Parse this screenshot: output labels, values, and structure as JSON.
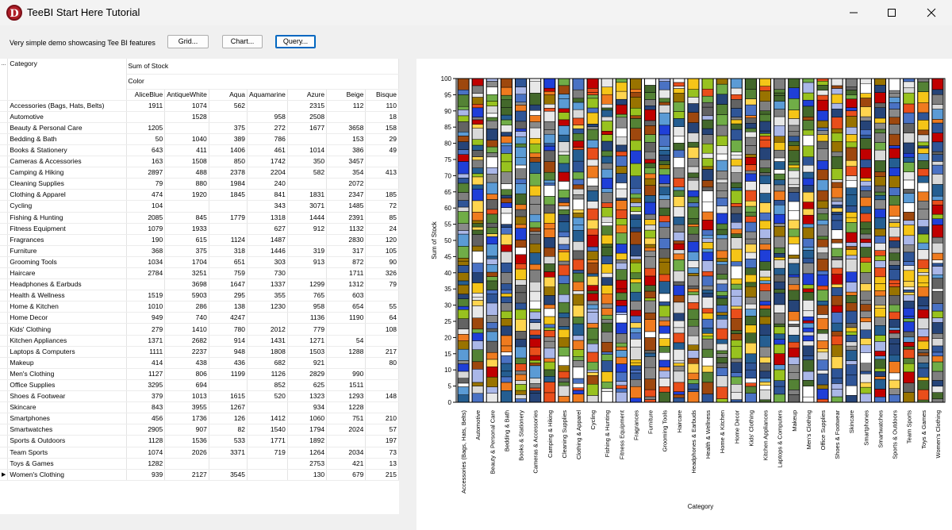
{
  "window": {
    "title": "TeeBI Start Here Tutorial",
    "app_icon_letter": "D"
  },
  "toolbar": {
    "description": "Very simple demo showcasing Tee BI features",
    "grid_label": "Grid...",
    "chart_label": "Chart...",
    "query_label": "Query..."
  },
  "grid": {
    "corner": "...",
    "category_header": "Category",
    "measure_header": "Sum of Stock",
    "column_group_header": "Color",
    "columns": [
      "AliceBlue",
      "AntiqueWhite",
      "Aqua",
      "Aquamarine",
      "Azure",
      "Beige",
      "Bisque"
    ],
    "row_indicator": "▶",
    "rows": [
      {
        "category": "Accessories (Bags, Hats, Belts)",
        "values": [
          "1911",
          "1074",
          "562",
          "",
          "2315",
          "112",
          "110"
        ]
      },
      {
        "category": "Automotive",
        "values": [
          "",
          "1528",
          "",
          "958",
          "2508",
          "",
          "18"
        ]
      },
      {
        "category": "Beauty & Personal Care",
        "values": [
          "1205",
          "",
          "375",
          "272",
          "1677",
          "3658",
          "158"
        ]
      },
      {
        "category": "Bedding & Bath",
        "values": [
          "50",
          "1040",
          "389",
          "786",
          "",
          "153",
          "29"
        ]
      },
      {
        "category": "Books & Stationery",
        "values": [
          "643",
          "411",
          "1406",
          "461",
          "1014",
          "386",
          "49"
        ]
      },
      {
        "category": "Cameras & Accessories",
        "values": [
          "163",
          "1508",
          "850",
          "1742",
          "350",
          "3457",
          ""
        ]
      },
      {
        "category": "Camping & Hiking",
        "values": [
          "2897",
          "488",
          "2378",
          "2204",
          "582",
          "354",
          "413"
        ]
      },
      {
        "category": "Cleaning Supplies",
        "values": [
          "79",
          "880",
          "1984",
          "240",
          "",
          "2072",
          ""
        ]
      },
      {
        "category": "Clothing & Apparel",
        "values": [
          "474",
          "1920",
          "1845",
          "841",
          "1831",
          "2347",
          "185"
        ]
      },
      {
        "category": "Cycling",
        "values": [
          "104",
          "",
          "",
          "343",
          "3071",
          "1485",
          "72"
        ]
      },
      {
        "category": "Fishing & Hunting",
        "values": [
          "2085",
          "845",
          "1779",
          "1318",
          "1444",
          "2391",
          "85"
        ]
      },
      {
        "category": "Fitness Equipment",
        "values": [
          "1079",
          "1933",
          "",
          "627",
          "912",
          "1132",
          "24"
        ]
      },
      {
        "category": "Fragrances",
        "values": [
          "190",
          "615",
          "1124",
          "1487",
          "",
          "2830",
          "120"
        ]
      },
      {
        "category": "Furniture",
        "values": [
          "368",
          "375",
          "318",
          "1446",
          "319",
          "317",
          "105"
        ]
      },
      {
        "category": "Grooming Tools",
        "values": [
          "1034",
          "1704",
          "651",
          "303",
          "913",
          "872",
          "90"
        ]
      },
      {
        "category": "Haircare",
        "values": [
          "2784",
          "3251",
          "759",
          "730",
          "",
          "1711",
          "326"
        ]
      },
      {
        "category": "Headphones & Earbuds",
        "values": [
          "",
          "3698",
          "1647",
          "1337",
          "1299",
          "1312",
          "79"
        ]
      },
      {
        "category": "Health & Wellness",
        "values": [
          "1519",
          "5903",
          "295",
          "355",
          "765",
          "603",
          ""
        ]
      },
      {
        "category": "Home & Kitchen",
        "values": [
          "1010",
          "286",
          "138",
          "1230",
          "958",
          "654",
          "55"
        ]
      },
      {
        "category": "Home Decor",
        "values": [
          "949",
          "740",
          "4247",
          "",
          "1136",
          "1190",
          "64"
        ]
      },
      {
        "category": "Kids' Clothing",
        "values": [
          "279",
          "1410",
          "780",
          "2012",
          "779",
          "",
          "108"
        ]
      },
      {
        "category": "Kitchen Appliances",
        "values": [
          "1371",
          "2682",
          "914",
          "1431",
          "1271",
          "54",
          ""
        ]
      },
      {
        "category": "Laptops & Computers",
        "values": [
          "1111",
          "2237",
          "948",
          "1808",
          "1503",
          "1288",
          "217"
        ]
      },
      {
        "category": "Makeup",
        "values": [
          "414",
          "438",
          "436",
          "682",
          "921",
          "",
          "80"
        ]
      },
      {
        "category": "Men's Clothing",
        "values": [
          "1127",
          "806",
          "1199",
          "1126",
          "2829",
          "990",
          ""
        ]
      },
      {
        "category": "Office Supplies",
        "values": [
          "3295",
          "694",
          "",
          "852",
          "625",
          "1511",
          ""
        ]
      },
      {
        "category": "Shoes & Footwear",
        "values": [
          "379",
          "1013",
          "1615",
          "520",
          "1323",
          "1293",
          "148"
        ]
      },
      {
        "category": "Skincare",
        "values": [
          "843",
          "3955",
          "1267",
          "",
          "934",
          "1228",
          ""
        ]
      },
      {
        "category": "Smartphones",
        "values": [
          "456",
          "1736",
          "126",
          "1412",
          "1060",
          "751",
          "210"
        ]
      },
      {
        "category": "Smartwatches",
        "values": [
          "2905",
          "907",
          "82",
          "1540",
          "1794",
          "2024",
          "57"
        ]
      },
      {
        "category": "Sports & Outdoors",
        "values": [
          "1128",
          "1536",
          "533",
          "1771",
          "1892",
          "",
          "197"
        ]
      },
      {
        "category": "Team Sports",
        "values": [
          "1074",
          "2026",
          "3371",
          "719",
          "1264",
          "2034",
          "73"
        ]
      },
      {
        "category": "Toys & Games",
        "values": [
          "1282",
          "",
          "",
          "",
          "2753",
          "421",
          "13"
        ]
      },
      {
        "category": "Women's Clothing",
        "values": [
          "939",
          "2127",
          "3545",
          "",
          "130",
          "679",
          "215"
        ]
      }
    ]
  },
  "chart_data": {
    "type": "bar",
    "stacking": "100% stacked",
    "ylabel": "Sum of Stock",
    "xlabel": "Category",
    "ylim": [
      0,
      100
    ],
    "yticks": [
      "0",
      "5",
      "10",
      "15",
      "20",
      "25",
      "30",
      "35",
      "40",
      "45",
      "50",
      "55",
      "60",
      "65",
      "70",
      "75",
      "80",
      "85",
      "90",
      "95",
      "100"
    ],
    "categories": [
      "Accessories (Bags, Hats, Belts)",
      "Automotive",
      "Beauty & Personal Care",
      "Bedding & Bath",
      "Books & Stationery",
      "Cameras & Accessories",
      "Camping & Hiking",
      "Cleaning Supplies",
      "Clothing & Apparel",
      "Cycling",
      "Fishing & Hunting",
      "Fitness Equipment",
      "Fragrances",
      "Furniture",
      "Grooming Tools",
      "Haircare",
      "Headphones & Earbuds",
      "Health & Wellness",
      "Home & Kitchen",
      "Home Decor",
      "Kids' Clothing",
      "Kitchen Appliances",
      "Laptops & Computers",
      "Makeup",
      "Men's Clothing",
      "Office Supplies",
      "Shoes & Footwear",
      "Skincare",
      "Smartphones",
      "Smartwatches",
      "Sports & Outdoors",
      "Team Sports",
      "Toys & Games",
      "Women's Clothing"
    ],
    "series_colors": [
      "#4a72c4",
      "#e8e8e8",
      "#ef7b1f",
      "#8a8a8a",
      "#f5c518",
      "#5b9bd5",
      "#70ad47",
      "#264478",
      "#9e480e",
      "#636363",
      "#997300",
      "#255e91",
      "#43682b",
      "#c00000",
      "#ffffff",
      "#1f3fd8",
      "#98c21f",
      "#aab7e8",
      "#d9d9d9",
      "#e94e1b",
      "#2f5597",
      "#ffd54f",
      "#548235",
      "#7f7f7f"
    ]
  }
}
